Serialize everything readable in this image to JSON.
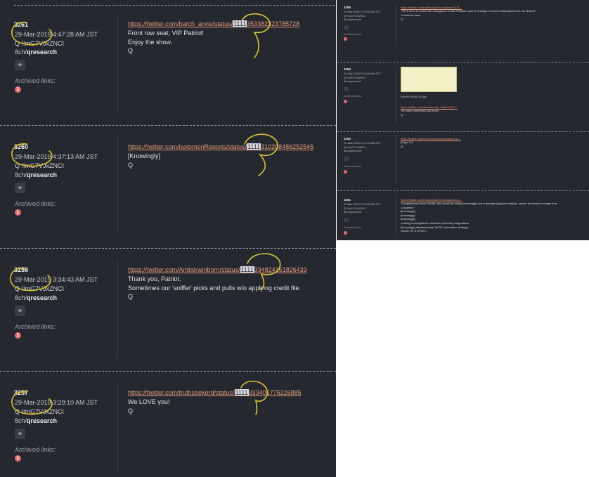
{
  "posts": [
    {
      "id": "3261",
      "date": "29-Mar-2019 4:47:28 AM JST",
      "trip": "Q  !!mG7VJxZNCI",
      "board_prefix": "8ch/",
      "board": "qresearch",
      "archived": "Archived links:",
      "badge": "1",
      "url_pre": "https://twitter.com/barch_anne/status/",
      "url_hl": "1111",
      "url_post": "353382323785728",
      "body": [
        "Front row seat, VIP Patriot!",
        "Enjoy the show.",
        "Q"
      ]
    },
    {
      "id": "3260",
      "date": "29-Mar-2019 4:37:13 AM JST",
      "trip": "Q  !!mG7VJxZNCI",
      "board_prefix": "8ch/",
      "board": "qresearch",
      "archived": "Archived links:",
      "badge": "1",
      "url_pre": "https://twitter.com/jsolomonReports/status/",
      "url_hl": "1111",
      "url_post": "310208486252545",
      "body": [
        "[Knowingly]",
        "Q"
      ]
    },
    {
      "id": "3258",
      "date": "29-Mar-2019 3:34:43 AM JST",
      "trip": "Q  !!mG7VJxZNCI",
      "board_prefix": "8ch/",
      "board": "qresearch",
      "archived": "Archived links:",
      "badge": "1",
      "url_pre": "https://twitter.com/Amberwinborn/status/",
      "url_hl": "1111",
      "url_post": "334824151826433",
      "body": [
        "Thank you, Patriot.",
        "Sometimes our 'sniffer' picks and pulls w/o applying credit file.",
        "Q"
      ]
    },
    {
      "id": "3257",
      "date": "29-Mar-2019 3:29:10 AM JST",
      "trip": "Q  !!mG7VJxZNCI",
      "board_prefix": "8ch/",
      "board": "qresearch",
      "archived": "Archived links:",
      "badge": "1",
      "url_pre": "https://twitter.com/truthseekerd/status/",
      "url_hl": "1111",
      "url_post": "333401775226885",
      "body": [
        "We LOVE you!",
        "Q"
      ]
    }
  ],
  "small_posts": [
    {
      "id": "3265",
      "date": "29-Mar-2019 5:22:09 AM JST",
      "trip": "Q  !!mG7VJxZNCI",
      "board": "8ch/qresearch",
      "archived": "Archived links:",
      "url": "https://twitter.com/realDonaldTrump/status/1111...",
      "body": [
        "\"FBI & DOJ to review the outrageous Jussie Smollett case in Chicago. It is an embarrassment to our Nation!\"",
        "-It shall be done.",
        "Q"
      ]
    },
    {
      "id": "3263",
      "date": "29-Mar-2019 5:20:48 AM JST",
      "trip": "Q  !!mG7VJxZNCI",
      "board": "8ch/qresearch",
      "archived": "Archived links:",
      "url": "https://twitter.com/seanhannity.../status/1111...",
      "body": [
        "You have more than you know.",
        "Q"
      ]
    },
    {
      "id": "3262",
      "date": "29-Mar-2019 5:09:31 AM JST",
      "trip": "Q  !!mG7VJxZNCI",
      "board": "8ch/qresearch",
      "archived": "Archived links:",
      "url": "https://twitter.com/RealJerryFalwell/status/1111...",
      "body": [
        "[Page 1?]",
        "Q"
      ]
    },
    {
      "id": "3261",
      "date": "29-Mar-2019 5:03:33 AM JST",
      "trip": "Q  !!mG7VJxZNCI",
      "board": "8ch/qresearch",
      "archived": "Archived links:",
      "url": "https://twitter.com/realDonaldTrump/status/1111...",
      "body": [
        "\"Congressman Adam Schiff, who spent two years [knowingly] and unlawfully lying and leaking, should be forced to resign from",
        "Congress!\"",
        "[Knowingly]",
        "[Knowingly]",
        "[Knowingly]",
        "Leaking investigations can lead to [forced] resignations.",
        "[Knowingly] disseminating FALSE information is illegal.",
        "GANG OF 8 (INTEL)"
      ]
    }
  ],
  "small_caption": "0d4ef97b5497d2.jpg"
}
